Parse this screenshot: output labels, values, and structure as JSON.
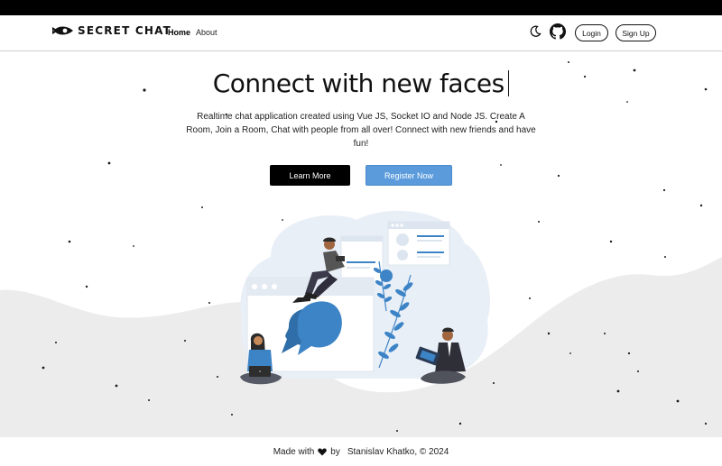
{
  "brand": {
    "name": "SECRET CHAT",
    "logo_icon": "rocket-icon"
  },
  "nav": {
    "home": "Home",
    "about": "About",
    "theme_icon": "moon-icon",
    "github_icon": "github-icon",
    "login": "Login",
    "signup": "Sign Up"
  },
  "hero": {
    "title": "Connect with new faces",
    "subtitle": "Realtime chat application created using Vue JS, Socket IO and Node JS. Create A Room, Join a Room, Chat with people from all over! Connect with new friends and have fun!",
    "learn_more": "Learn More",
    "register": "Register Now"
  },
  "footer": {
    "made_with": "Made with",
    "heart_icon": "heart-icon",
    "by": "by",
    "author": "Stanislav Khatko, © 2024"
  },
  "colors": {
    "accent_blue": "#5b9bdc",
    "illustration_blue": "#3d84c6",
    "dark": "#000000",
    "hill_gray": "#ececec"
  }
}
